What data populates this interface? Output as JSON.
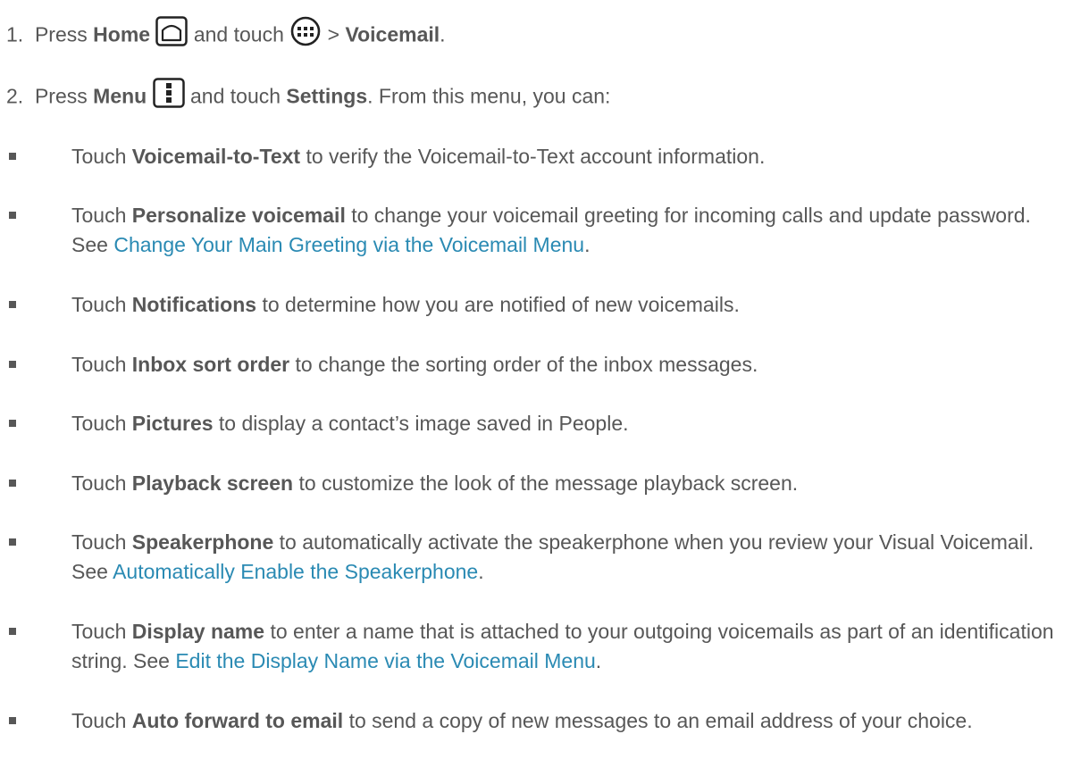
{
  "steps": [
    {
      "number": "1.",
      "pre": "Press",
      "home_label": "Home",
      "mid": "and touch",
      "sep": ">",
      "voicemail_label": "Voicemail",
      "end": "."
    },
    {
      "number": "2.",
      "pre": "Press",
      "menu_label": "Menu",
      "mid": "and touch",
      "settings_label": "Settings",
      "end": ". From this menu, you can:"
    }
  ],
  "bullets": [
    {
      "pre": "Touch",
      "bold": "Voicemail-to-Text",
      "text": "to verify the Voicemail-to-Text account information."
    },
    {
      "pre": "Touch",
      "bold": "Personalize voicemail",
      "text": "to change your voicemail greeting for incoming calls and update password. See",
      "link": "Change Your Main Greeting via the Voicemail Menu",
      "end": "."
    },
    {
      "pre": "Touch",
      "bold": "Notifications",
      "text": "to determine how you are notified of new voicemails."
    },
    {
      "pre": "Touch",
      "bold": "Inbox sort order",
      "text": "to change the sorting order of the inbox messages."
    },
    {
      "pre": "Touch",
      "bold": "Pictures",
      "text": "to display a contact’s image saved in People."
    },
    {
      "pre": "Touch",
      "bold": "Playback screen",
      "text": "to customize the look of the message playback screen."
    },
    {
      "pre": "Touch",
      "bold": "Speakerphone",
      "text": "to automatically activate the speakerphone when you review your Visual Voicemail. See",
      "link": "Automatically Enable the Speakerphone",
      "end": "."
    },
    {
      "pre": "Touch",
      "bold": "Display name",
      "text": "to enter a name that is attached to your outgoing voicemails as part of an identification string. See",
      "link": "Edit the Display Name via the Voicemail Menu",
      "end": "."
    },
    {
      "pre": "Touch",
      "bold": "Auto forward to email",
      "text": "to send a copy of new messages to an email address of your choice."
    }
  ]
}
